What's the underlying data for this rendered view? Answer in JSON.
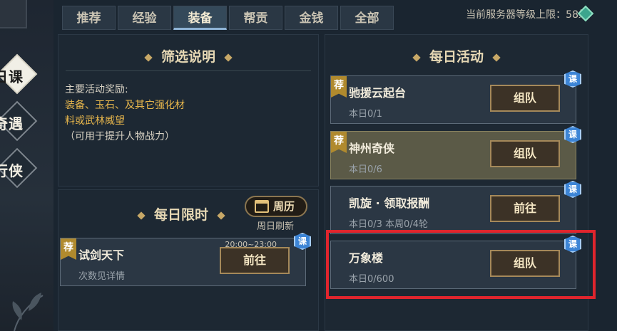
{
  "side_nav": [
    {
      "label": "日课",
      "active": true
    },
    {
      "label": "奇遇",
      "active": false
    },
    {
      "label": "行侠",
      "active": false
    }
  ],
  "tabs": [
    {
      "label": "推荐",
      "active": false
    },
    {
      "label": "经验",
      "active": false
    },
    {
      "label": "装备",
      "active": true
    },
    {
      "label": "帮贡",
      "active": false
    },
    {
      "label": "金钱",
      "active": false
    },
    {
      "label": "全部",
      "active": false
    }
  ],
  "server_info": "当前服务器等级上限：58级",
  "filter": {
    "title": "筛选说明",
    "line1": "主要活动奖励:",
    "line2": "装备、玉石、及其它强化材",
    "line3": "料或武林威望",
    "line4": "（可用于提升人物战力）"
  },
  "limited": {
    "title": "每日限时",
    "calendar_label": "周历",
    "calendar_sub": "周日刷新",
    "items": [
      {
        "tag": "荐",
        "name": "试剑天下",
        "sub": "次数见详情",
        "time": "20:00~23:00",
        "button": "前往",
        "badge": "课"
      }
    ]
  },
  "daily": {
    "title": "每日活动",
    "items": [
      {
        "tag": "荐",
        "name": "驰援云起台",
        "sub": "本日0/1",
        "button": "组队",
        "badge": "课"
      },
      {
        "tag": "荐",
        "name": "神州奇侠",
        "sub": "本日0/6",
        "button": "组队",
        "badge": "课"
      },
      {
        "name": "凯旋 · 领取报酬",
        "sub": "本日0/3  本周0/4轮",
        "button": "前往",
        "badge": "课"
      },
      {
        "name": "万象楼",
        "sub": "本日0/600",
        "button": "组队",
        "badge": "课"
      }
    ]
  },
  "colors": {
    "accent_gold": "#e7b64c",
    "highlight_red": "#e0252d",
    "badge_blue": "#3d85d6"
  }
}
